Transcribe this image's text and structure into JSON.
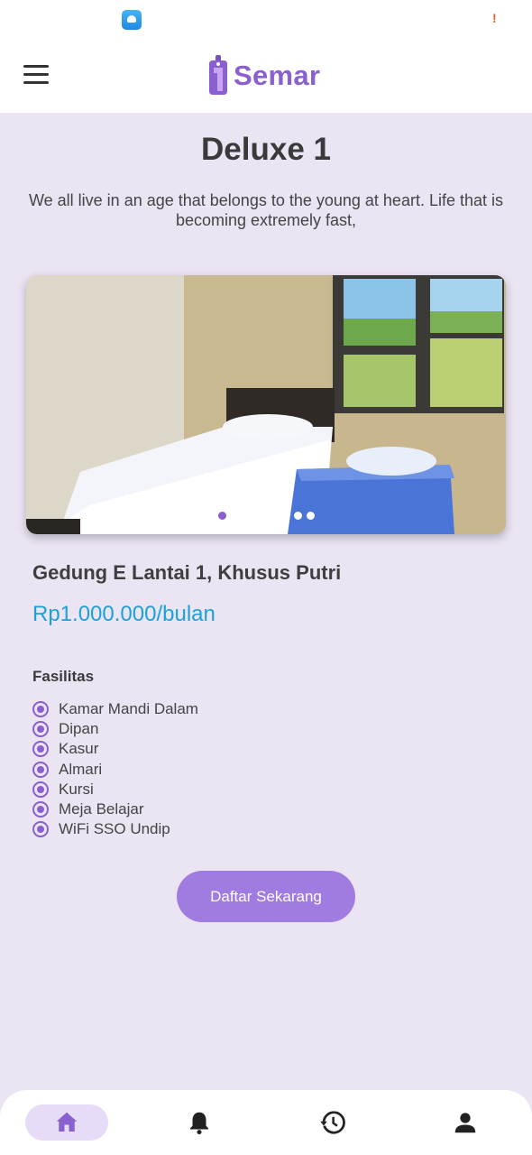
{
  "status_bar": {
    "alert_glyph": "!"
  },
  "header": {
    "logo_text": "Semar",
    "brand_color": "#8a5fcf"
  },
  "room": {
    "title": "Deluxe 1",
    "description": "We all live in an age that belongs to the young at heart. Life that is becoming extremely fast,",
    "name": "Gedung E Lantai 1, Khusus Putri",
    "price": "Rp1.000.000/bulan",
    "carousel": {
      "total_slides": 8,
      "active_index": 0
    }
  },
  "facilities": {
    "title": "Fasilitas",
    "items": [
      "Kamar Mandi Dalam",
      "Dipan",
      "Kasur",
      "Almari",
      "Kursi",
      "Meja Belajar",
      "WiFi SSO Undip"
    ]
  },
  "cta": {
    "label": "Daftar Sekarang"
  },
  "bottom_nav": {
    "items": [
      {
        "icon": "home-icon",
        "active": true
      },
      {
        "icon": "bell-icon",
        "active": false
      },
      {
        "icon": "history-icon",
        "active": false
      },
      {
        "icon": "person-icon",
        "active": false
      }
    ]
  }
}
